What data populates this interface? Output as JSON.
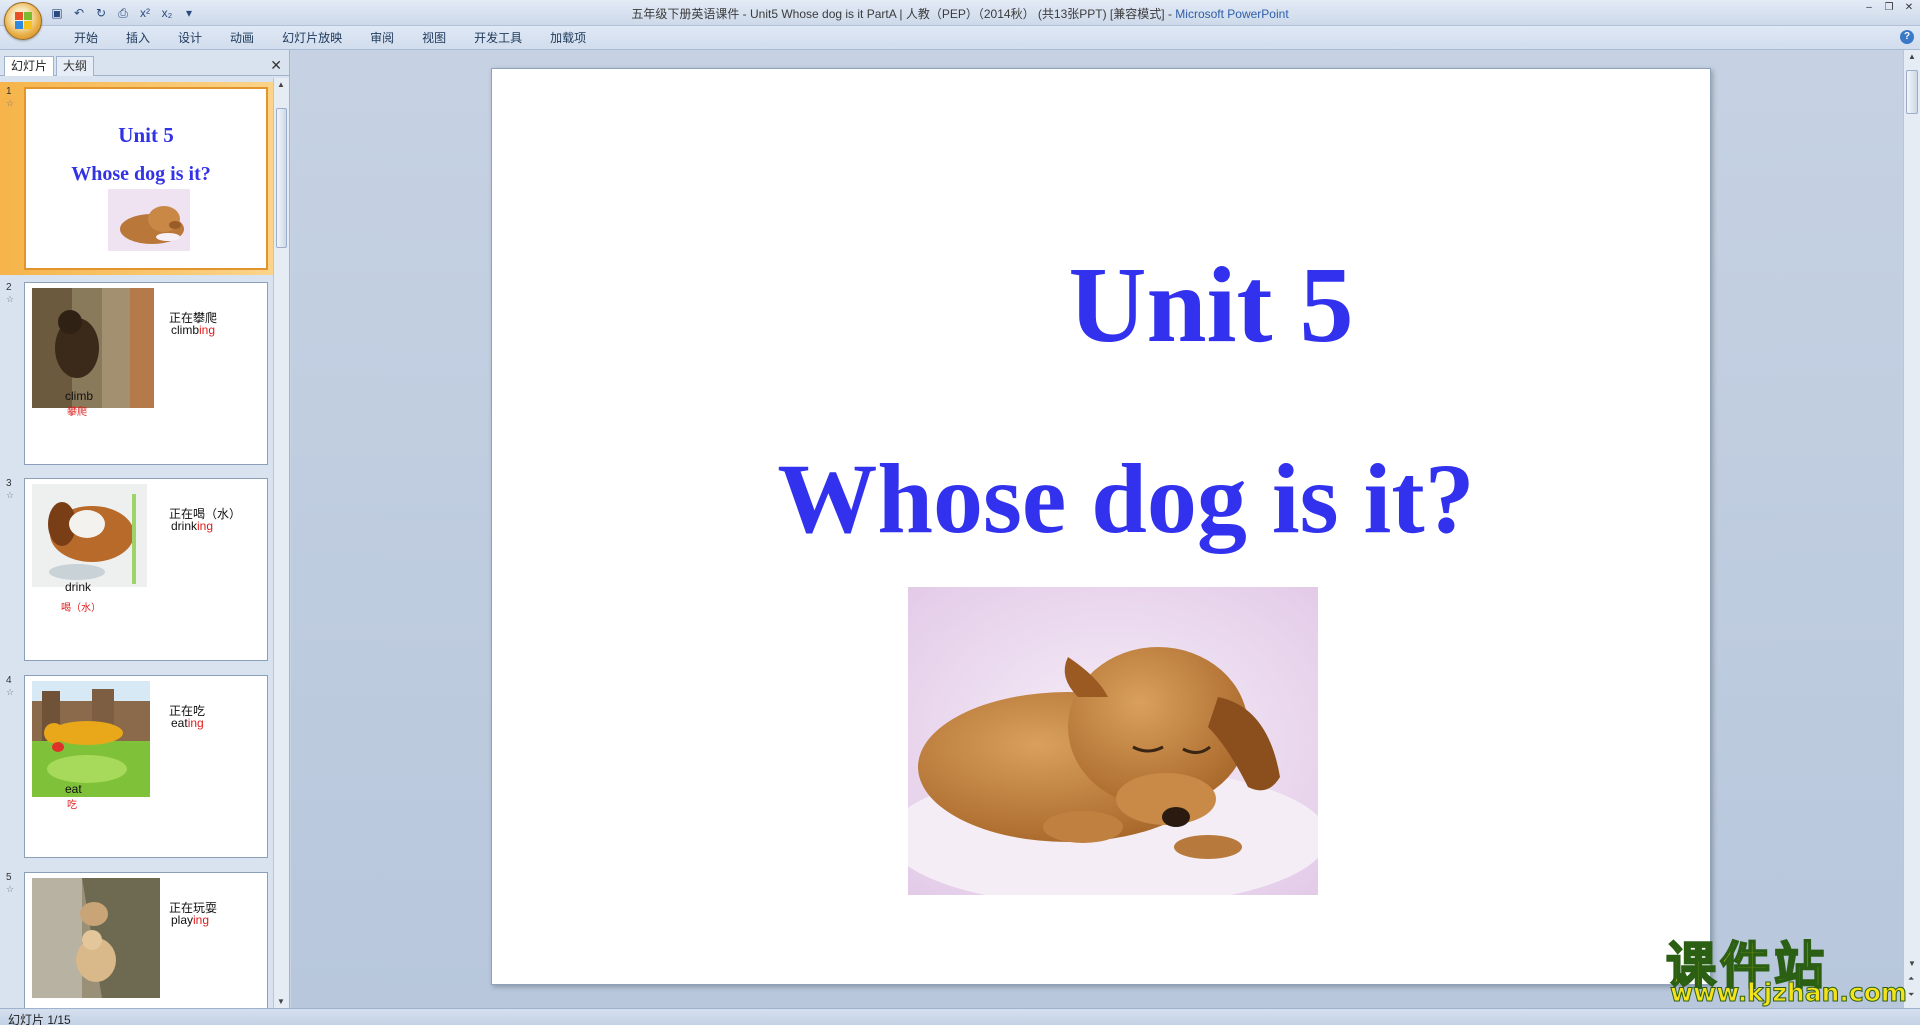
{
  "window": {
    "title": "五年级下册英语课件 - Unit5 Whose dog is it PartA  | 人教（PEP）（2014秋）  (共13张PPT) [兼容模式]",
    "title_app": "Microsoft PowerPoint",
    "controls": [
      "‒",
      "❐",
      "✕"
    ]
  },
  "qat": {
    "icons": [
      "save-icon",
      "undo-icon",
      "redo-icon",
      "print-preview-icon",
      "superscript-icon",
      "subscript-icon",
      "customize-icon"
    ],
    "labels": [
      "▣",
      "↶",
      "↻",
      "⎙",
      "x²",
      "x₂",
      "▾"
    ]
  },
  "ribbon": {
    "tabs": [
      "开始",
      "插入",
      "设计",
      "动画",
      "幻灯片放映",
      "审阅",
      "视图",
      "开发工具",
      "加载项"
    ],
    "help": "?"
  },
  "panel": {
    "tab_slides": "幻灯片",
    "tab_outline": "大纲",
    "close": "✕"
  },
  "thumbnails": [
    {
      "num": "1",
      "star": "☆",
      "title": "Unit 5",
      "subtitle": "Whose dog is it?"
    },
    {
      "num": "2",
      "star": "☆",
      "cn": "正在攀爬",
      "en_base": "climb",
      "en_suffix": "ing",
      "word": "climb",
      "word_cn": "攀爬"
    },
    {
      "num": "3",
      "star": "☆",
      "cn": "正在喝（水）",
      "en_base": "drink",
      "en_suffix": "ing",
      "word": "drink",
      "word_cn": "喝（水）"
    },
    {
      "num": "4",
      "star": "☆",
      "cn": "正在吃",
      "en_base": "eat",
      "en_suffix": "ing",
      "word": "eat",
      "word_cn": "吃"
    },
    {
      "num": "5",
      "star": "☆",
      "cn": "正在玩耍",
      "en_base": "play",
      "en_suffix": "ing"
    }
  ],
  "slide": {
    "title": "Unit 5",
    "subtitle": "Whose dog is it?"
  },
  "status": {
    "slide_counter": "幻灯片 1/15"
  },
  "watermark": {
    "cn": "课件站",
    "url": "www.kjzhan.com"
  },
  "colors": {
    "slide_text": "#3232ee",
    "highlight": "#e01b1b",
    "selected_thumb": "#f6b44a"
  }
}
